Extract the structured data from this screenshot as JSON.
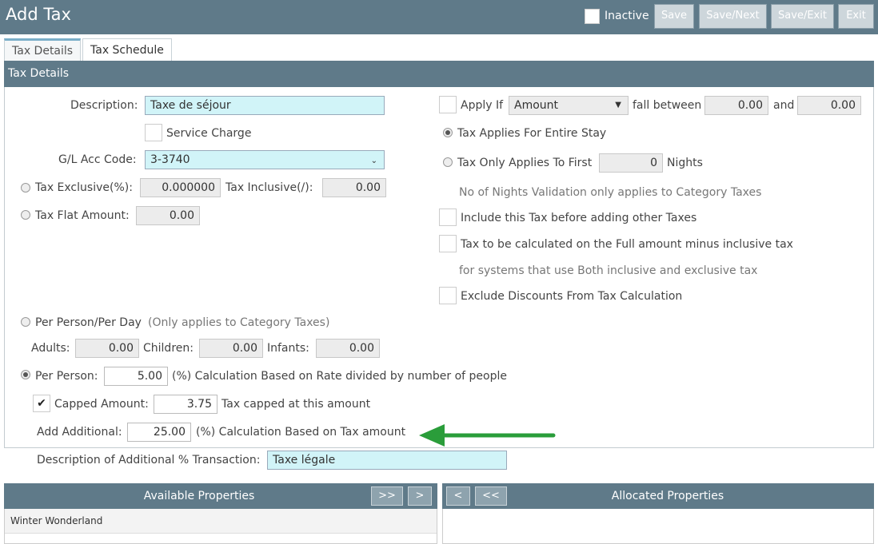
{
  "window": {
    "title": "Add Tax"
  },
  "toolbar": {
    "inactive_label": "Inactive",
    "save": "Save",
    "save_next": "Save/Next",
    "save_exit": "Save/Exit",
    "exit": "Exit"
  },
  "tabs": [
    {
      "label": "Tax Details"
    },
    {
      "label": "Tax Schedule"
    }
  ],
  "section_title": "Tax Details",
  "left": {
    "description_label": "Description:",
    "description_value": "Taxe de séjour",
    "service_charge_label": "Service Charge",
    "gl_label": "G/L Acc Code:",
    "gl_value": "3-3740",
    "tax_exclusive_label": "Tax Exclusive(%):",
    "tax_exclusive_value": "0.000000",
    "tax_inclusive_label": "Tax Inclusive(/):",
    "tax_inclusive_value": "0.00",
    "flat_amount_label": "Tax Flat Amount:",
    "flat_amount_value": "0.00",
    "per_person_day_label": "Per Person/Per Day",
    "per_person_day_note": "(Only applies to Category Taxes)",
    "adults_label": "Adults:",
    "adults_value": "0.00",
    "children_label": "Children:",
    "children_value": "0.00",
    "infants_label": "Infants:",
    "infants_value": "0.00",
    "per_person_label": "Per Person:",
    "per_person_value": "5.00",
    "per_person_note": "(%) Calculation Based on Rate divided by number of people",
    "capped_label": "Capped Amount:",
    "capped_value": "3.75",
    "capped_note": "Tax capped at this amount",
    "add_additional_label": "Add Additional:",
    "add_additional_value": "25.00",
    "add_additional_note": "(%) Calculation Based on Tax amount",
    "desc_additional_label": "Description of Additional % Transaction:",
    "desc_additional_value": "Taxe légale"
  },
  "right": {
    "apply_if_label": "Apply If",
    "apply_if_select": "Amount",
    "fall_between_label": "fall between",
    "between_from": "0.00",
    "and_label": "and",
    "between_to": "0.00",
    "entire_stay_label": "Tax Applies For Entire Stay",
    "first_label": "Tax Only Applies To First",
    "first_value": "0",
    "nights_label": "Nights",
    "nights_note": "No of Nights Validation only applies to Category Taxes",
    "include_before_label": "Include this Tax before adding other Taxes",
    "full_amount_label": "Tax to be calculated on the Full amount minus inclusive tax",
    "full_amount_note": "for systems that use Both inclusive and exclusive tax",
    "exclude_discounts_label": "Exclude Discounts From Tax Calculation"
  },
  "properties": {
    "available_title": "Available Properties",
    "allocated_title": "Allocated Properties",
    "move_all_right": ">>",
    "move_right": ">",
    "move_left": "<",
    "move_all_left": "<<",
    "available_items": [
      "Winter Wonderland"
    ]
  },
  "colors": {
    "header": "#5f7a89",
    "arrow": "#2a9d3a",
    "field_highlight": "#d1f4f8"
  }
}
